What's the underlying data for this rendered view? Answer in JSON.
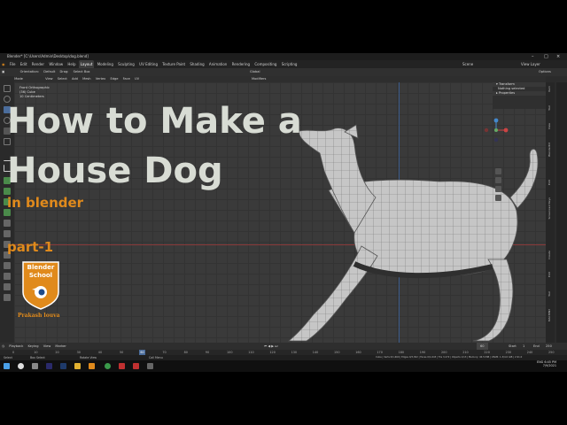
{
  "window": {
    "title": "Blender* [C:\\Users\\Admin\\Desktop\\dog.blend]"
  },
  "menu": {
    "items": [
      "File",
      "Edit",
      "Render",
      "Window",
      "Help"
    ]
  },
  "workspaces": {
    "tabs": [
      "Layout",
      "Modeling",
      "Sculpting",
      "UV Editing",
      "Texture Paint",
      "Shading",
      "Animation",
      "Rendering",
      "Compositing",
      "Scripting"
    ],
    "active": "Layout"
  },
  "scene": {
    "name": "Scene",
    "view_layer": "View Layer"
  },
  "toolbar": {
    "orientation_label": "Orientation:",
    "orientation_value": "Default",
    "drag_label": "Drag:",
    "drag_value": "Select Box",
    "transform_global": "Global",
    "options": "Options"
  },
  "viewport_header": {
    "mode": "Edit Mode",
    "menus": [
      "View",
      "Select",
      "Add",
      "Mesh",
      "Vertex",
      "Edge",
      "Face",
      "UV"
    ],
    "shading": "Modifiers"
  },
  "viewport_overlay": {
    "line1": "Front Orthographic",
    "line2": "(36) Cube",
    "line3": "10 Centimeters"
  },
  "thumbnail": {
    "title_line1": "How to Make a",
    "title_line2": "House Dog",
    "subtitle": "in blender",
    "part": "part-1",
    "badge_line1": "Blender",
    "badge_line2": "School",
    "author": "Prakash louva"
  },
  "npanel": {
    "transform": "Transform",
    "nothing_selected": "Nothing selected",
    "properties": "Properties",
    "tabs": [
      "Item",
      "Tool",
      "View",
      "BlenderKit",
      "Edit",
      "Screencast Keys",
      "Create",
      "Edit",
      "Tool",
      "MACHIN3"
    ]
  },
  "timeline": {
    "menus": [
      "Playback",
      "Keying",
      "View",
      "Marker"
    ],
    "current_frame": "60",
    "start_label": "Start",
    "start_value": "1",
    "end_label": "End",
    "end_value": "250",
    "ticks": [
      "0",
      "10",
      "20",
      "30",
      "40",
      "50",
      "60",
      "70",
      "80",
      "90",
      "100",
      "110",
      "120",
      "130",
      "140",
      "150",
      "160",
      "170",
      "180",
      "190",
      "200",
      "210",
      "220",
      "230",
      "240",
      "250"
    ]
  },
  "statusbar": {
    "select": "Select",
    "box_select": "Box Select",
    "rotate_view": "Rotate View",
    "call_menu": "Call Menu",
    "stats": "Cube | Verts 0/1,669 | Edges 0/3,302 | Faces 0/1,643 | Tris 3,272 | Objects 1/13 | Memory: 46.5 MiB | VRAM: 1.3/4.0 GiB | 2.91.0"
  },
  "taskbar": {
    "time": "6:45 PM",
    "date": "7/9/2021",
    "lang": "ENG"
  },
  "colors": {
    "accent": "#e08a1c",
    "title_text": "#d8dcd4",
    "active_blue": "#4b6d9c",
    "mesh": "#c9c9c9"
  }
}
